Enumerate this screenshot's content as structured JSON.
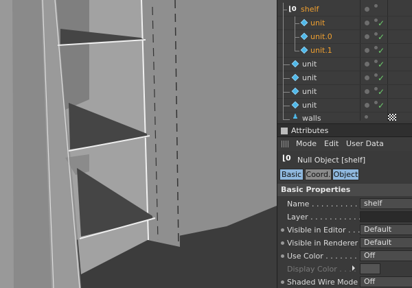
{
  "object_manager": {
    "rows": [
      {
        "label": "shelf",
        "color": "orange",
        "icon": "null-object-icon",
        "check": false
      },
      {
        "label": "unit",
        "color": "orange",
        "icon": "cube-icon",
        "check": true
      },
      {
        "label": "unit.0",
        "color": "orange",
        "icon": "cube-icon",
        "check": true
      },
      {
        "label": "unit.1",
        "color": "orange",
        "icon": "cube-icon",
        "check": true
      },
      {
        "label": "unit",
        "color": "grey",
        "icon": "cube-icon",
        "check": true
      },
      {
        "label": "unit",
        "color": "grey",
        "icon": "cube-icon",
        "check": true
      },
      {
        "label": "unit",
        "color": "grey",
        "icon": "cube-icon",
        "check": true
      },
      {
        "label": "unit",
        "color": "grey",
        "icon": "cube-icon",
        "check": true
      },
      {
        "label": "walls",
        "color": "grey",
        "icon": "figure-icon",
        "check": false
      }
    ]
  },
  "attributes": {
    "title": "Attributes",
    "menu": [
      "Mode",
      "Edit",
      "User Data"
    ],
    "object_title": "Null Object [shelf]",
    "tabs": [
      {
        "label": "Basic",
        "active": true
      },
      {
        "label": "Coord.",
        "active": false
      },
      {
        "label": "Object",
        "active": true
      }
    ],
    "section": "Basic Properties",
    "properties": [
      {
        "label": "Name . . . . . . . . . . . .",
        "value": "shelf",
        "dot": false,
        "dim": false
      },
      {
        "label": "Layer . . . . . . . . . . . .",
        "value": "",
        "dot": false,
        "dim": false
      },
      {
        "label": "Visible in Editor . . . . .",
        "value": "Default",
        "dot": true,
        "dim": false
      },
      {
        "label": "Visible in Renderer . .",
        "value": "Default",
        "dot": true,
        "dim": false
      },
      {
        "label": "Use Color . . . . . . . .",
        "value": "Off",
        "dot": true,
        "dim": false
      },
      {
        "label": "Display Color . . . .",
        "value": "",
        "dot": false,
        "dim": true
      },
      {
        "label": "Shaded Wire Mode",
        "value": "Off",
        "dot": true,
        "dim": false
      }
    ]
  }
}
